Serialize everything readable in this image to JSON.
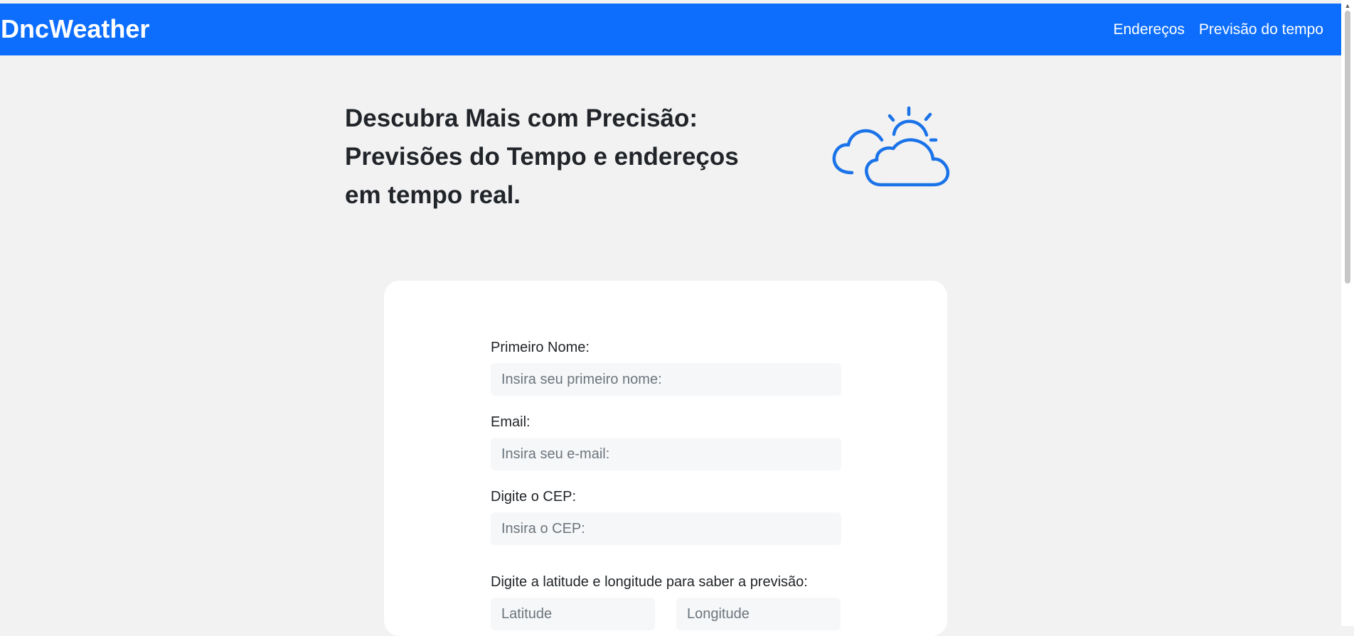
{
  "navbar": {
    "brand": "DncWeather",
    "links": [
      {
        "label": "Endereços"
      },
      {
        "label": "Previsão do tempo"
      }
    ],
    "background": "#0d6efd"
  },
  "hero": {
    "title": "Descubra Mais com Precisão: Previsões do Tempo e endereços em tempo real.",
    "icon": "partly-cloudy-icon",
    "icon_color": "#0d6efd"
  },
  "form": {
    "first_name": {
      "label": "Primeiro Nome:",
      "placeholder": "Insira seu primeiro nome:",
      "value": ""
    },
    "email": {
      "label": "Email:",
      "placeholder": "Insira seu e-mail:",
      "value": ""
    },
    "cep": {
      "label": "Digite o CEP:",
      "placeholder": "Insira o CEP:",
      "value": ""
    },
    "coordinates": {
      "label": "Digite a latitude e longitude para saber a previsão:",
      "latitude_placeholder": "Latitude",
      "longitude_placeholder": "Longitude"
    }
  }
}
